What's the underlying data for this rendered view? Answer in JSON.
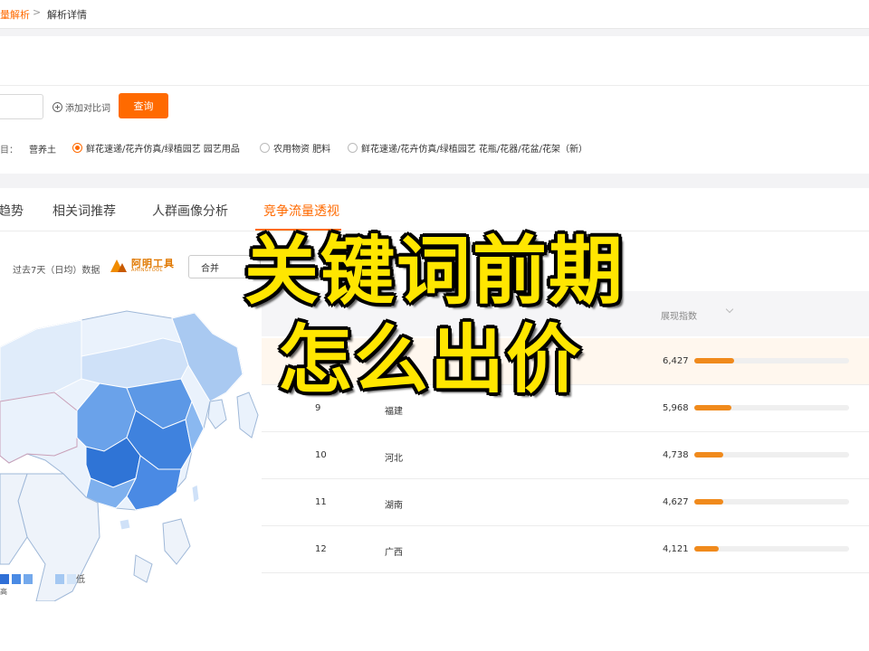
{
  "breadcrumb": {
    "previous": "量解析",
    "separator": ">",
    "current": "解析详情"
  },
  "search": {
    "keyword_value": "",
    "add_compare_label": "添加对比词",
    "query_label": "查询"
  },
  "categories": {
    "label_suffix": "目：",
    "first_keyword": "营养土",
    "options": [
      {
        "label": "鲜花速递/花卉仿真/绿植园艺 园艺用品",
        "selected": true
      },
      {
        "label": "农用物资 肥料",
        "selected": false
      },
      {
        "label": "鲜花速递/花卉仿真/绿植园艺 花瓶/花器/花盆/花架（新）",
        "selected": false
      }
    ]
  },
  "tabs": [
    {
      "label": "趋势",
      "active": false
    },
    {
      "label": "相关词推荐",
      "active": false
    },
    {
      "label": "人群画像分析",
      "active": false
    },
    {
      "label": "竞争流量透视",
      "active": true
    }
  ],
  "toolbar": {
    "period_label": "过去7天（日均）数据",
    "brand_name": "阿明工具",
    "brand_sub": "AMINGTOOL",
    "merge_button_label": "合并"
  },
  "map": {
    "legend_colors": [
      "#2f6fd6",
      "#4a8ae4",
      "#74a9ec",
      "#a4c8f2",
      "#d2e4f8"
    ],
    "legend_low": "低",
    "legend_high": "高"
  },
  "table": {
    "column_region": "",
    "column_impressions": "展现指数",
    "rows": [
      {
        "rank": "",
        "region": "",
        "value": "6,427",
        "fill": 0.26,
        "highlight": true
      },
      {
        "rank": "9",
        "region": "福建",
        "value": "5,968",
        "fill": 0.24,
        "highlight": false
      },
      {
        "rank": "10",
        "region": "河北",
        "value": "4,738",
        "fill": 0.19,
        "highlight": false
      },
      {
        "rank": "11",
        "region": "湖南",
        "value": "4,627",
        "fill": 0.19,
        "highlight": false
      },
      {
        "rank": "12",
        "region": "广西",
        "value": "4,121",
        "fill": 0.16,
        "highlight": false
      }
    ]
  },
  "overlay": {
    "line1": "关键词前期",
    "line2": "怎么出价"
  },
  "colors": {
    "accent": "#ff6a00",
    "bar": "#f08a1c",
    "caption": "#ffe600"
  }
}
